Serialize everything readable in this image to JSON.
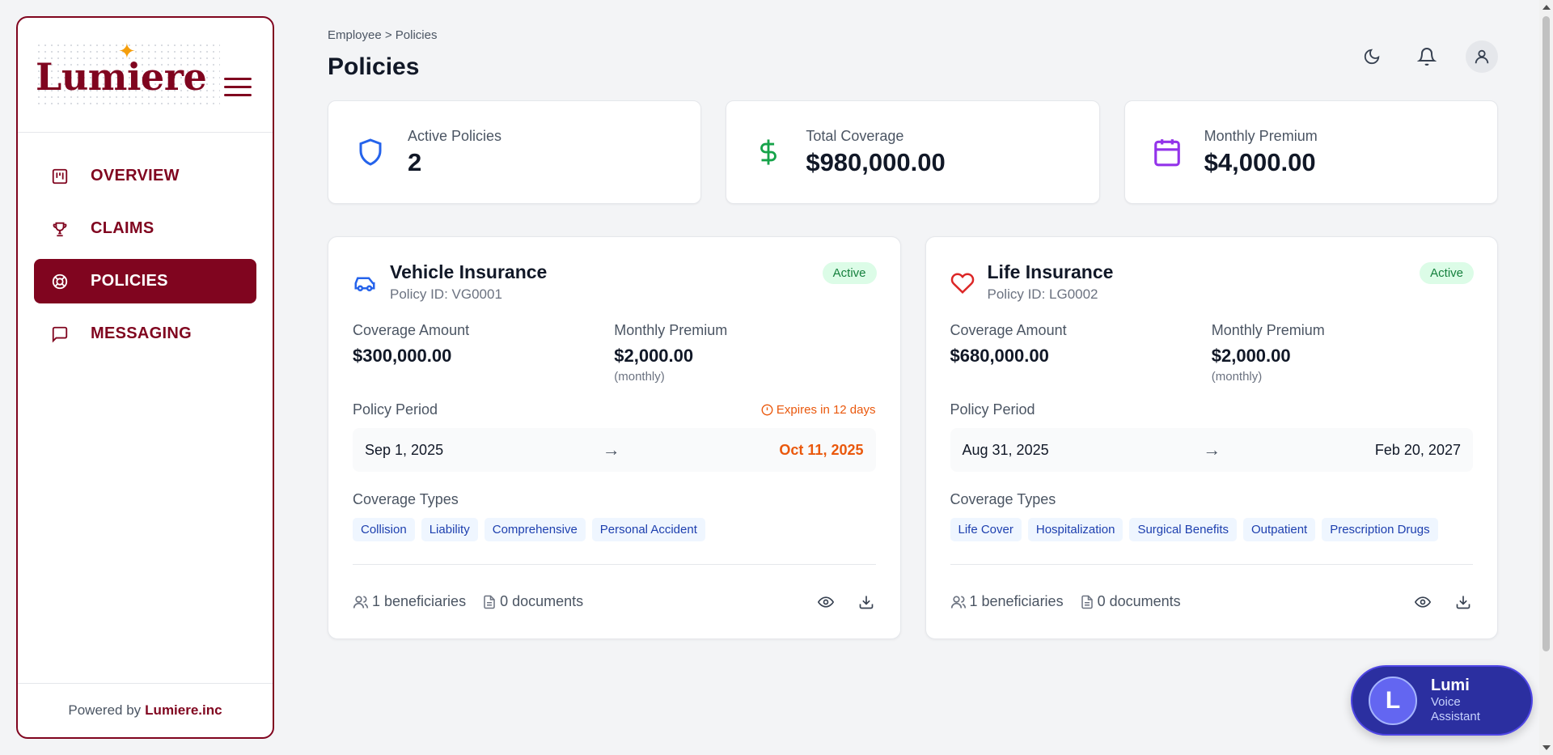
{
  "brand": {
    "logo_text": "Lumiere",
    "accent": "#80051f"
  },
  "sidebar": {
    "items": [
      {
        "label": "OVERVIEW",
        "icon": "kanban-icon"
      },
      {
        "label": "CLAIMS",
        "icon": "trophy-icon"
      },
      {
        "label": "POLICIES",
        "icon": "lifebuoy-icon",
        "active": true
      },
      {
        "label": "MESSAGING",
        "icon": "message-square-icon"
      }
    ],
    "footer_prefix": "Powered by",
    "footer_brand": "Lumiere.inc"
  },
  "header": {
    "breadcrumb": "Employee > Policies",
    "title": "Policies"
  },
  "stats": [
    {
      "label": "Active Policies",
      "value": "2",
      "icon": "shield-icon",
      "color": "#2563eb"
    },
    {
      "label": "Total Coverage",
      "value": "$980,000.00",
      "icon": "dollar-icon",
      "color": "#16a34a"
    },
    {
      "label": "Monthly Premium",
      "value": "$4,000.00",
      "icon": "calendar-icon",
      "color": "#9333ea"
    }
  ],
  "policies": [
    {
      "title": "Vehicle Insurance",
      "policy_id": "Policy ID: VG0001",
      "status": "Active",
      "coverage_label": "Coverage Amount",
      "coverage": "$300,000.00",
      "premium_label": "Monthly Premium",
      "premium": "$2,000.00",
      "premium_sub": "(monthly)",
      "period_label": "Policy Period",
      "expires": "Expires in 12 days",
      "start": "Sep 1, 2025",
      "arrow": "→",
      "end": "Oct 11, 2025",
      "types_label": "Coverage Types",
      "types": [
        "Collision",
        "Liability",
        "Comprehensive",
        "Personal Accident"
      ],
      "beneficiaries": "1 beneficiaries",
      "documents": "0 documents"
    },
    {
      "title": "Life Insurance",
      "policy_id": "Policy ID: LG0002",
      "status": "Active",
      "coverage_label": "Coverage Amount",
      "coverage": "$680,000.00",
      "premium_label": "Monthly Premium",
      "premium": "$2,000.00",
      "premium_sub": "(monthly)",
      "period_label": "Policy Period",
      "start": "Aug 31, 2025",
      "arrow": "→",
      "end": "Feb 20, 2027",
      "types_label": "Coverage Types",
      "types": [
        "Life Cover",
        "Hospitalization",
        "Surgical Benefits",
        "Outpatient",
        "Prescription Drugs"
      ],
      "beneficiaries": "1 beneficiaries",
      "documents": "0 documents"
    }
  ],
  "assistant": {
    "avatar": "L",
    "name": "Lumi",
    "subtitle": "Voice Assistant"
  }
}
